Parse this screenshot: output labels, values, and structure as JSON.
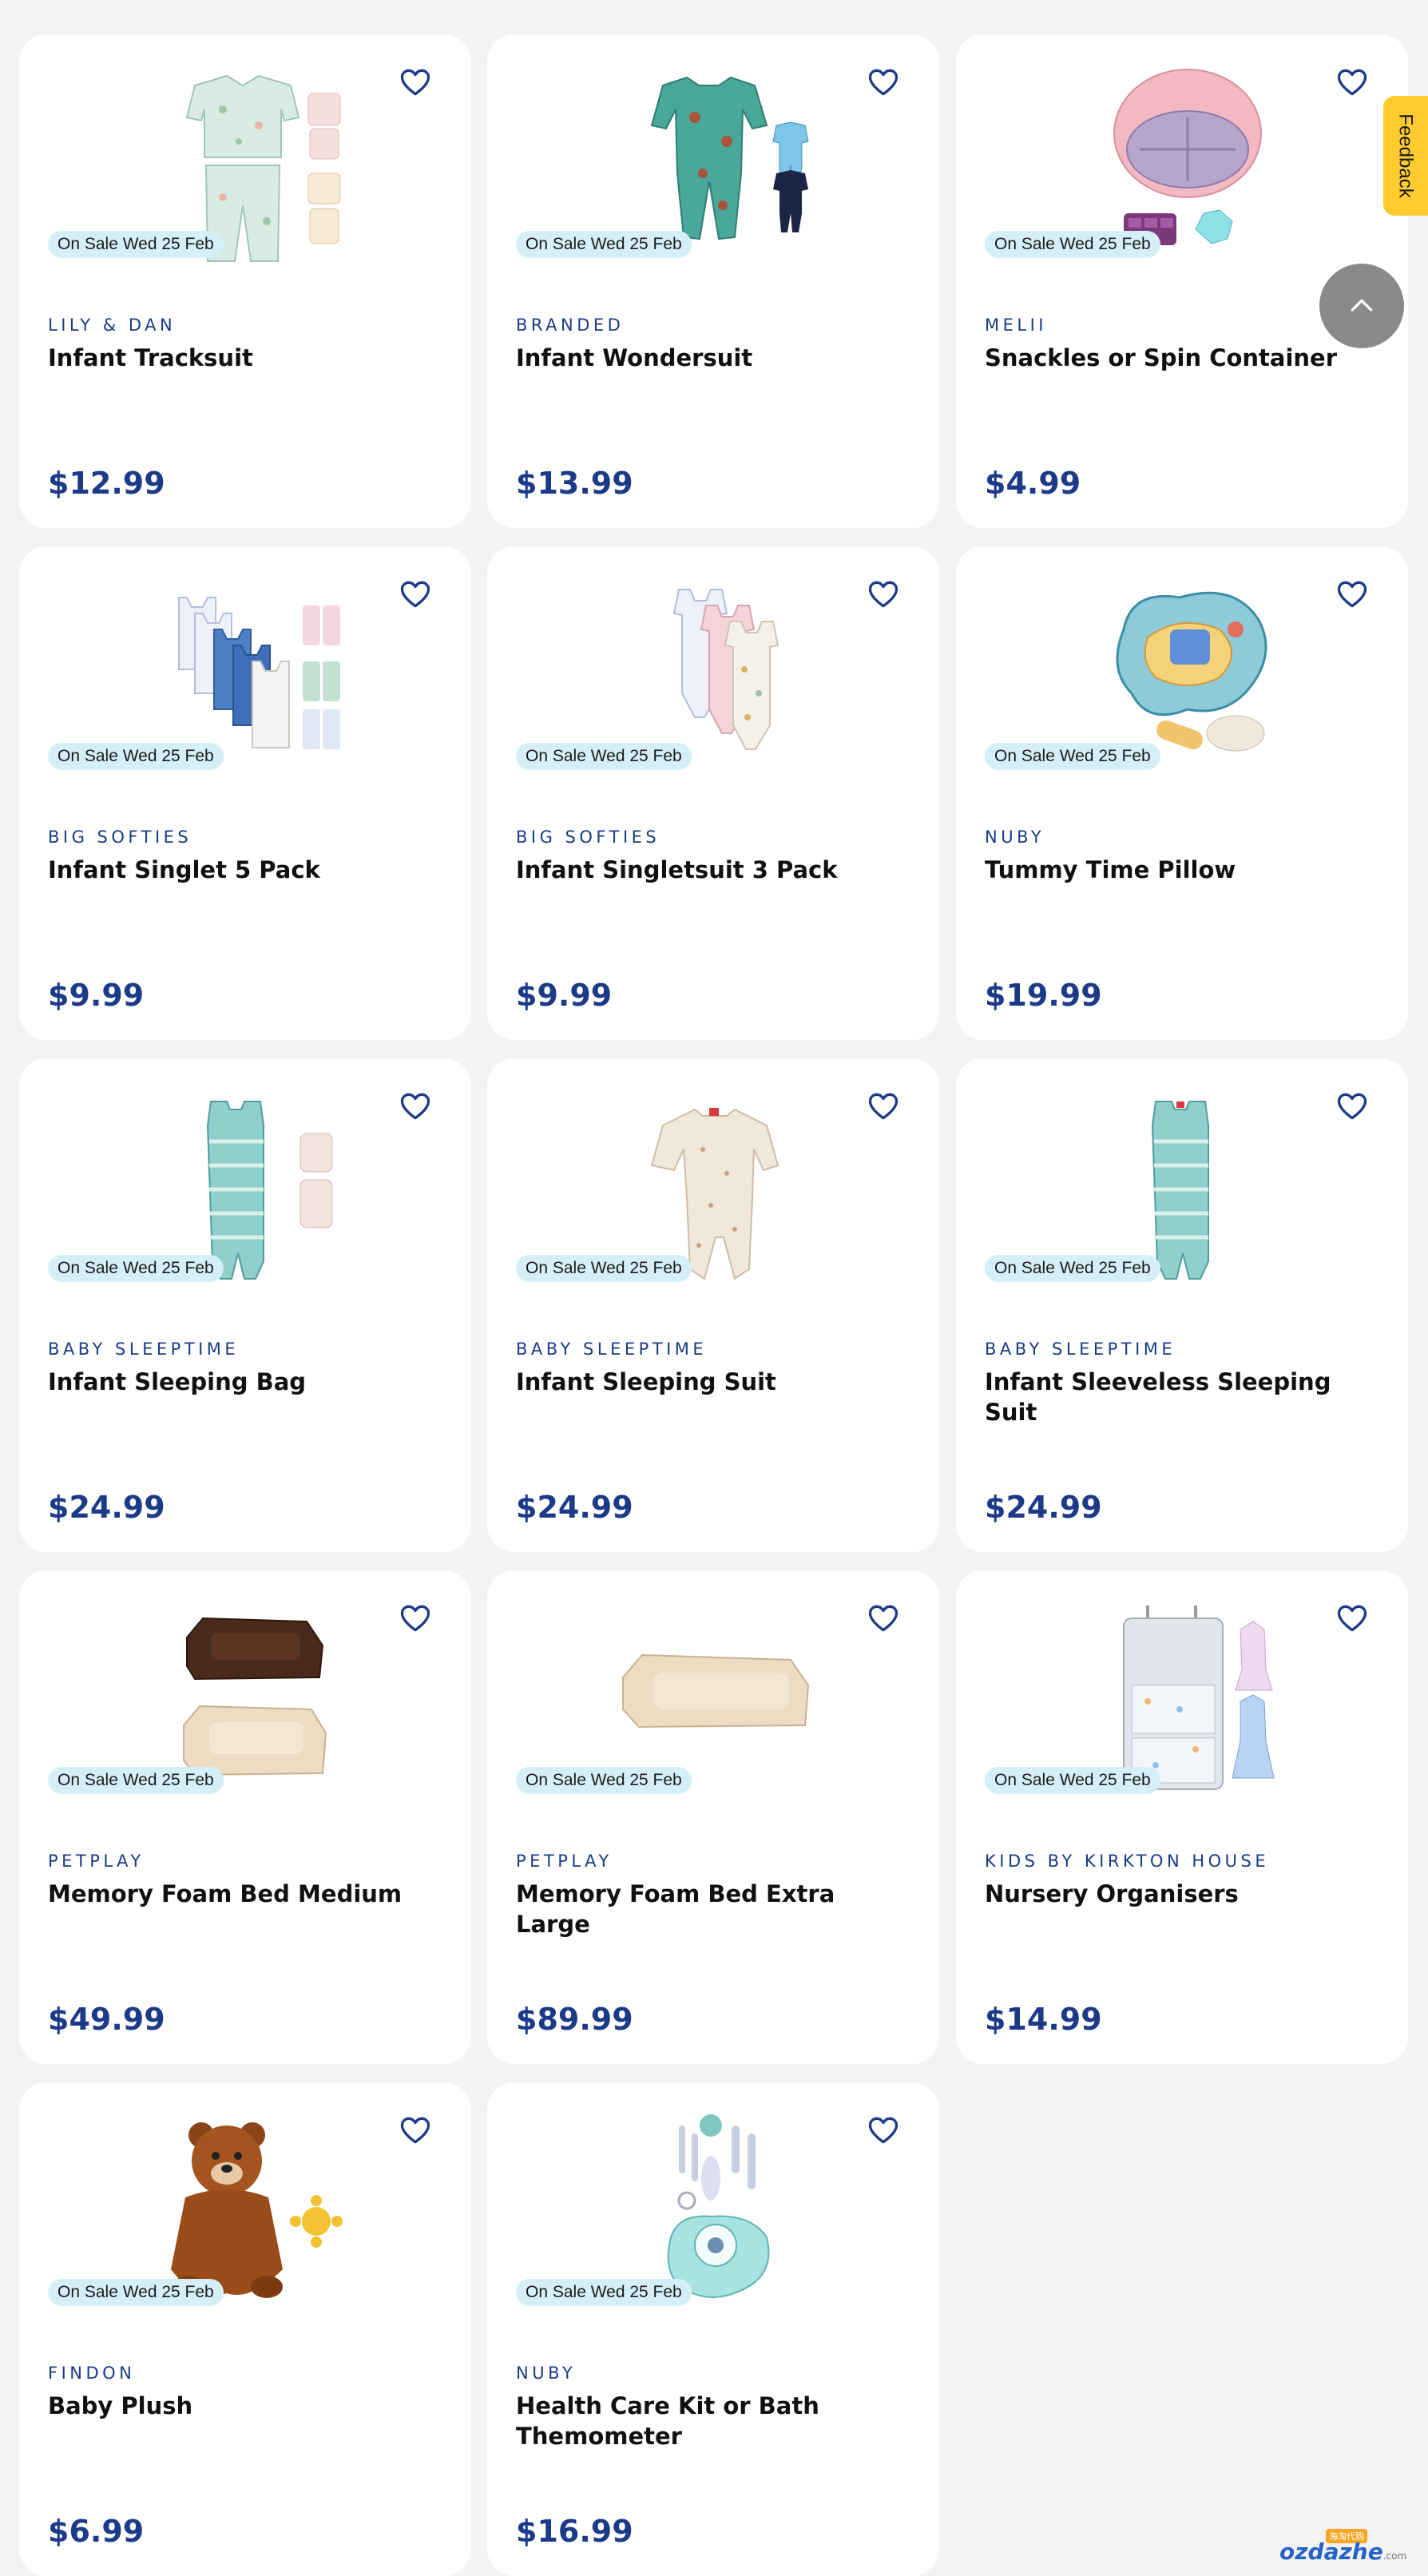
{
  "products": [
    {
      "brand": "LILY & DAN",
      "name": "Infant Tracksuit",
      "price": "$12.99",
      "badge": "On Sale Wed 25 Feb"
    },
    {
      "brand": "BRANDED",
      "name": "Infant Wondersuit",
      "price": "$13.99",
      "badge": "On Sale Wed 25 Feb"
    },
    {
      "brand": "MELII",
      "name": "Snackles or Spin Container",
      "price": "$4.99",
      "badge": "On Sale Wed 25 Feb"
    },
    {
      "brand": "BIG SOFTIES",
      "name": "Infant Singlet 5 Pack",
      "price": "$9.99",
      "badge": "On Sale Wed 25 Feb"
    },
    {
      "brand": "BIG SOFTIES",
      "name": "Infant Singletsuit 3 Pack",
      "price": "$9.99",
      "badge": "On Sale Wed 25 Feb"
    },
    {
      "brand": "NUBY",
      "name": "Tummy Time Pillow",
      "price": "$19.99",
      "badge": "On Sale Wed 25 Feb"
    },
    {
      "brand": "BABY SLEEPTIME",
      "name": "Infant Sleeping Bag",
      "price": "$24.99",
      "badge": "On Sale Wed 25 Feb"
    },
    {
      "brand": "BABY SLEEPTIME",
      "name": "Infant Sleeping Suit",
      "price": "$24.99",
      "badge": "On Sale Wed 25 Feb"
    },
    {
      "brand": "BABY SLEEPTIME",
      "name": "Infant Sleeveless Sleeping Suit",
      "price": "$24.99",
      "badge": "On Sale Wed 25 Feb"
    },
    {
      "brand": "PETPLAY",
      "name": "Memory Foam Bed Medium",
      "price": "$49.99",
      "badge": "On Sale Wed 25 Feb"
    },
    {
      "brand": "PETPLAY",
      "name": "Memory Foam Bed Extra Large",
      "price": "$89.99",
      "badge": "On Sale Wed 25 Feb"
    },
    {
      "brand": "KIDS BY KIRKTON HOUSE",
      "name": "Nursery Organisers",
      "price": "$14.99",
      "badge": "On Sale Wed 25 Feb"
    },
    {
      "brand": "FINDON",
      "name": "Baby Plush",
      "price": "$6.99",
      "badge": "On Sale Wed 25 Feb"
    },
    {
      "brand": "NUBY",
      "name": "Health Care Kit or Bath Themometer",
      "price": "$16.99",
      "badge": "On Sale Wed 25 Feb"
    }
  ],
  "feedback": {
    "label": "Feedback"
  },
  "watermark": {
    "tag": "海淘代购",
    "text": "ozdazhe",
    "suffix": ".com"
  },
  "icons": {
    "wishlist": "heart-outline-icon",
    "scroll_top": "chevron-up-icon"
  },
  "colors": {
    "price": "#1b3a87",
    "badge_bg": "#d5eff8",
    "feedback_bg": "#ffcb2e",
    "page_bg": "#f3f3f3"
  }
}
